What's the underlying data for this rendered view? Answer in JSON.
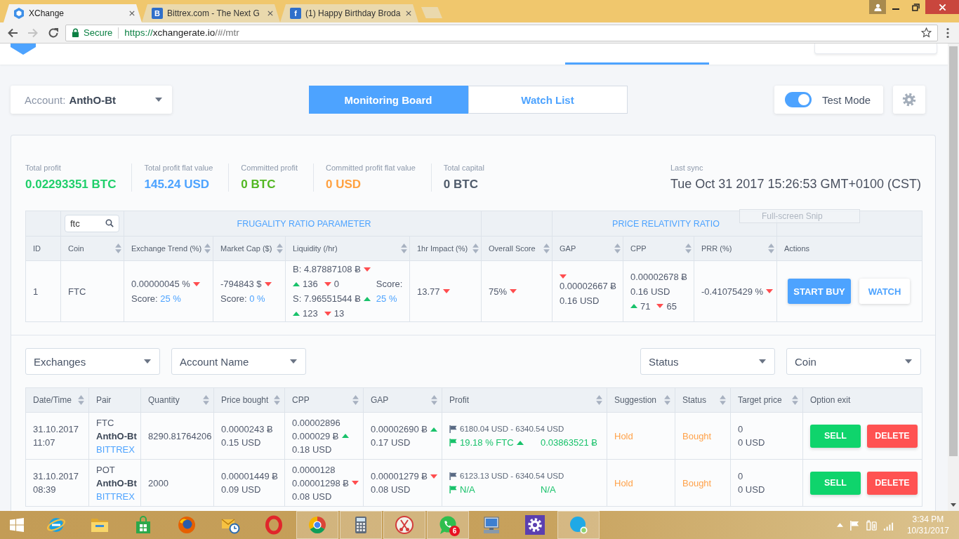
{
  "browser": {
    "tabs": [
      {
        "title": "XChange",
        "selected": true,
        "favicon": {
          "kind": "hexagon"
        }
      },
      {
        "title": "Bittrex.com - The Next G",
        "selected": false,
        "favicon": {
          "kind": "letter",
          "text": "B"
        }
      },
      {
        "title": "(1) Happy Birthday Broda",
        "selected": false,
        "favicon": {
          "kind": "letter",
          "text": "f"
        }
      }
    ],
    "forward_disabled": true,
    "secure_label": "Secure",
    "url_scheme": "https://",
    "url_host": "xchangerate.io",
    "url_path": "/#/mtr"
  },
  "account": {
    "label": "Account:",
    "value": "AnthO-Bt"
  },
  "views": [
    {
      "label": "Monitoring Board",
      "selected": true
    },
    {
      "label": "Watch List",
      "selected": false
    }
  ],
  "test_mode": {
    "label": "Test Mode",
    "on": true
  },
  "stats": [
    {
      "label": "Total profit",
      "value": "0.02293351 BTC",
      "color": "#1fcf6a"
    },
    {
      "label": "Total profit flat value",
      "value": "145.24 USD",
      "color": "#4da3ff"
    },
    {
      "label": "Committed profit",
      "value": "0 BTC",
      "color": "#52b722"
    },
    {
      "label": "Committed profit flat value",
      "value": "0 USD",
      "color": "#ffa140"
    },
    {
      "label": "Total capital",
      "value": "0 BTC",
      "color": "#4f5b6b"
    }
  ],
  "last_sync": {
    "label": "Last sync",
    "value": "Tue Oct 31 2017 15:26:53 GMT+0100 (CST)"
  },
  "snip_tooltip": "Full-screen Snip",
  "filter_table": {
    "groups": [
      {
        "kind": "blank",
        "columns": [
          {
            "label": "ID",
            "sortable": false
          }
        ]
      },
      {
        "kind": "search",
        "value": "ftc",
        "columns": [
          {
            "label": "Coin",
            "sortable": true
          }
        ]
      },
      {
        "kind": "title",
        "title": "FRUGALITY RATIO PARAMETER",
        "columns": [
          {
            "label": "Exchange Trend (%)",
            "sortable": true
          },
          {
            "label": "Market Cap ($)",
            "sortable": true
          },
          {
            "label": "Liquidity (/hr)",
            "sortable": true
          },
          {
            "label": "1hr Impact (%)",
            "sortable": true
          }
        ]
      },
      {
        "kind": "blank",
        "columns": [
          {
            "label": "Overall Score",
            "sortable": true
          }
        ]
      },
      {
        "kind": "title",
        "title": "PRICE RELATIVITY RATIO",
        "columns": [
          {
            "label": "GAP",
            "sortable": true
          },
          {
            "label": "CPP",
            "sortable": true
          },
          {
            "label": "PRR (%)",
            "sortable": true
          }
        ]
      },
      {
        "kind": "blank",
        "columns": [
          {
            "label": "Actions",
            "sortable": false
          }
        ]
      }
    ],
    "rows": [
      {
        "id": "1",
        "coin": "FTC",
        "exchange_trend": {
          "value": "0.00000045 %",
          "rising": false,
          "score_label": "Score:",
          "score": "25 %"
        },
        "market_cap": {
          "value": "-794843 $",
          "rising": false,
          "score_label": "Score:",
          "score": "0 %"
        },
        "liquidity": {
          "buy": {
            "value": "B: 4.87887108 Ƀ",
            "rising": false,
            "up": "136",
            "down": "0"
          },
          "sell": {
            "value": "S: 7.96551544 Ƀ",
            "rising": true,
            "up": "123",
            "down": "13"
          },
          "score_label": "Score:",
          "score": "25 %"
        },
        "impact": {
          "value": "13.77",
          "rising": false
        },
        "overall": {
          "value": "75%",
          "rising": false
        },
        "gap": {
          "rising": false,
          "btc": "0.00002667 Ƀ",
          "usd": "0.16 USD"
        },
        "cpp": {
          "btc": "0.00002678 Ƀ",
          "usd": "0.16 USD",
          "up": "71",
          "down": "65"
        },
        "prr": {
          "value": "-0.41075429 %",
          "rising": false
        },
        "actions": [
          {
            "label": "START BUY",
            "kind": "primary"
          },
          {
            "label": "WATCH",
            "kind": "secondary"
          }
        ]
      }
    ]
  },
  "trade_filters": {
    "left": [
      {
        "label": "Exchanges"
      },
      {
        "label": "Account Name"
      }
    ],
    "right": [
      {
        "label": "Status"
      },
      {
        "label": "Coin"
      }
    ]
  },
  "trades_table": {
    "columns": [
      {
        "label": "Date/Time",
        "sortable": true
      },
      {
        "label": "Pair",
        "sortable": false
      },
      {
        "label": "Quantity",
        "sortable": true
      },
      {
        "label": "Price bought",
        "sortable": true
      },
      {
        "label": "CPP",
        "sortable": true
      },
      {
        "label": "GAP",
        "sortable": true
      },
      {
        "label": "Profit",
        "sortable": true
      },
      {
        "label": "Suggestion",
        "sortable": true
      },
      {
        "label": "Status",
        "sortable": true
      },
      {
        "label": "Target price",
        "sortable": true
      },
      {
        "label": "Option exit",
        "sortable": false
      }
    ],
    "rows": [
      {
        "date": "31.10.2017",
        "time": "11:07",
        "pair": {
          "coin": "FTC",
          "account": "AnthO-Bt",
          "exchange": "BITTREX"
        },
        "quantity": "8290.81764206",
        "price_bought": {
          "btc": "0.0000243 Ƀ",
          "usd": "0.15 USD"
        },
        "cpp": {
          "value": "0.00002896",
          "btc": "0.000029 Ƀ",
          "rising": true,
          "usd": "0.18 USD"
        },
        "gap": {
          "btc": "0.00002690 Ƀ",
          "rising": true,
          "usd": "0.17 USD"
        },
        "profit": {
          "range": "6180.04 USD - 6340.54 USD",
          "percent": "19.18 % FTC",
          "rising": true,
          "amount": "0.03863521 Ƀ"
        },
        "suggestion": "Hold",
        "status": "Bought",
        "target": {
          "price": "0",
          "usd": "0 USD"
        },
        "actions": [
          {
            "label": "SELL",
            "kind": "sell"
          },
          {
            "label": "DELETE",
            "kind": "delete"
          }
        ]
      },
      {
        "date": "31.10.2017",
        "time": "08:39",
        "pair": {
          "coin": "POT",
          "account": "AnthO-Bt",
          "exchange": "BITTREX"
        },
        "quantity": "2000",
        "price_bought": {
          "btc": "0.00001449 Ƀ",
          "usd": "0.09 USD"
        },
        "cpp": {
          "value": "0.0000128",
          "btc": "0.00001298 Ƀ",
          "rising": false,
          "usd": "0.08 USD"
        },
        "gap": {
          "btc": "0.00001279 Ƀ",
          "rising": false,
          "usd": "0.08 USD"
        },
        "profit": {
          "range": "6123.13 USD - 6340.54 USD",
          "percent": "N/A",
          "amount": "N/A"
        },
        "suggestion": "Hold",
        "status": "Bought",
        "target": {
          "price": "0",
          "usd": "0 USD"
        },
        "actions": [
          {
            "label": "SELL",
            "kind": "sell"
          },
          {
            "label": "DELETE",
            "kind": "delete"
          }
        ]
      }
    ]
  },
  "taskbar": {
    "apps": [
      {
        "kind": "ie",
        "running": false
      },
      {
        "kind": "explorer",
        "running": false
      },
      {
        "kind": "store",
        "running": false
      },
      {
        "kind": "firefox",
        "running": false
      },
      {
        "kind": "mail",
        "running": false
      },
      {
        "kind": "opera",
        "running": false
      },
      {
        "kind": "chrome",
        "running": true
      },
      {
        "kind": "calculator",
        "running": true
      },
      {
        "kind": "snipping",
        "running": true
      },
      {
        "kind": "whatsapp",
        "running": true,
        "badge": "6"
      },
      {
        "kind": "remote",
        "running": false
      },
      {
        "kind": "settings",
        "running": false
      },
      {
        "kind": "skype",
        "running": true
      }
    ],
    "clock": {
      "time": "3:34 PM",
      "date": "10/31/2017"
    }
  }
}
